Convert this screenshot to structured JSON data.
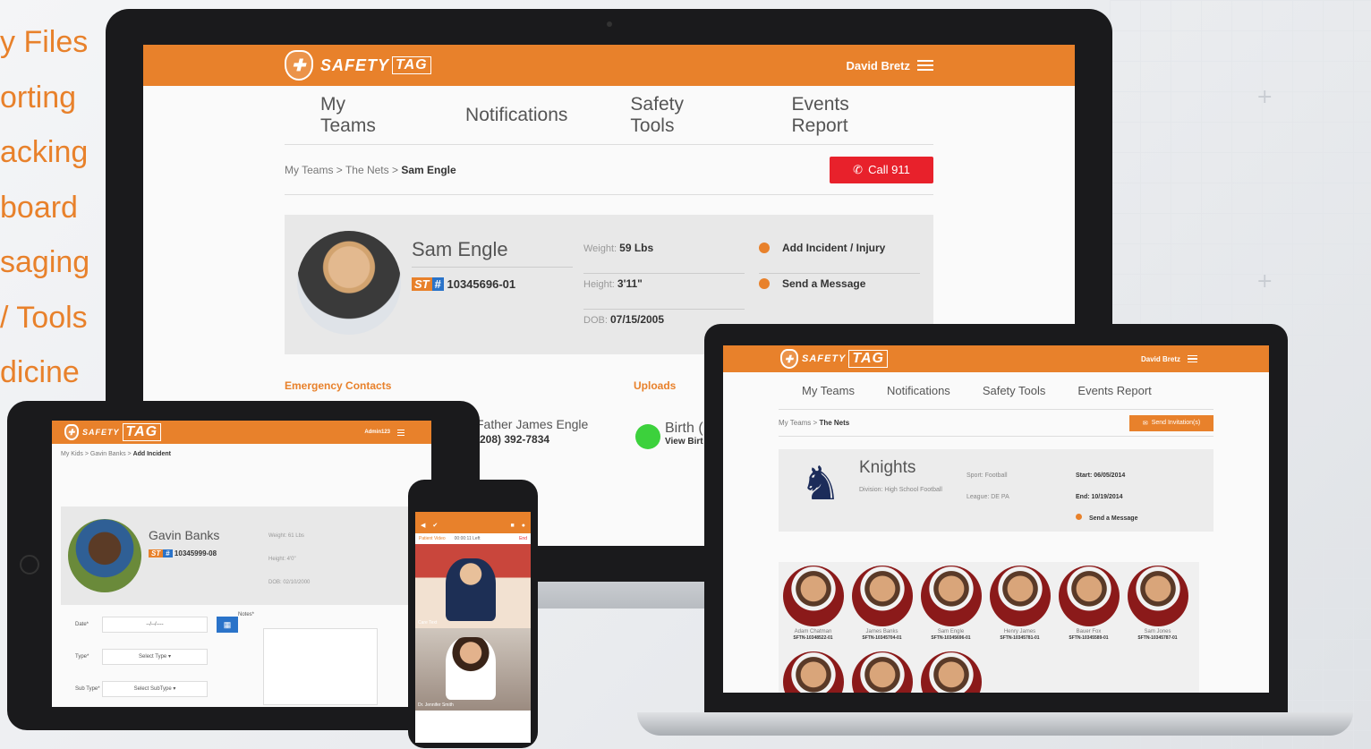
{
  "features": [
    "y Files",
    "orting",
    "acking",
    "board",
    "saging",
    "/ Tools",
    "dicine"
  ],
  "desktop": {
    "logo": "SAFETY",
    "logo_tag": "TAG",
    "user": "David Bretz",
    "nav": [
      "My Teams",
      "Notifications",
      "Safety Tools",
      "Events Report"
    ],
    "breadcrumb": [
      "My Teams",
      "The Nets"
    ],
    "breadcrumb_current": "Sam Engle",
    "call_911": "Call 911",
    "player": {
      "name": "Sam Engle",
      "st_label": "ST",
      "st_id": "10345696-01",
      "weight_label": "Weight:",
      "weight": "59 Lbs",
      "height_label": "Height:",
      "height": "3'11\"",
      "dob_label": "DOB:",
      "dob": "07/15/2005"
    },
    "actions": [
      "Add Incident / Injury",
      "Send a Message"
    ],
    "emergency_title": "Emergency Contacts",
    "uploads_title": "Uploads",
    "contact_name": "Father James Engle",
    "contact_phone": "(208) 392-7834",
    "upload_name": "Birth (",
    "upload_link": "View Birt"
  },
  "laptop": {
    "logo": "SAFETY",
    "logo_tag": "TAG",
    "user": "David Bretz",
    "nav": [
      "My Teams",
      "Notifications",
      "Safety Tools",
      "Events Report"
    ],
    "breadcrumb": [
      "My Teams"
    ],
    "breadcrumb_current": "The Nets",
    "invite_button": "Send Invitation(s)",
    "team": {
      "name": "Knights",
      "sub": "Division: High School Football",
      "sport": "Sport: Football",
      "league": "League: DE PA",
      "start": "Start: 06/05/2014",
      "end": "End: 10/19/2014",
      "message": "Send a Message"
    },
    "roster": [
      {
        "name": "Adam Chatman",
        "id": "SFTN-10348522-01"
      },
      {
        "name": "James Banks",
        "id": "SFTN-10345704-01"
      },
      {
        "name": "Sam Engle",
        "id": "SFTN-10345696-01"
      },
      {
        "name": "Henry James",
        "id": "SFTN-10345781-01"
      },
      {
        "name": "Bauer Fox",
        "id": "SFTN-10345589-01"
      },
      {
        "name": "Sam Jones",
        "id": "SFTN-10345787-01"
      },
      {
        "name": "",
        "id": ""
      },
      {
        "name": "",
        "id": ""
      },
      {
        "name": "",
        "id": ""
      }
    ]
  },
  "tablet": {
    "logo": "SAFETY",
    "logo_tag": "TAG",
    "user": "Admin123",
    "breadcrumb": [
      "My Kids",
      "Gavin Banks"
    ],
    "breadcrumb_current": "Add Incident",
    "player": {
      "name": "Gavin Banks",
      "st_label": "ST",
      "st_id": "10345999-08",
      "weight": "Weight: 61 Lbs",
      "height": "Height: 4'0\"",
      "dob": "DOB: 02/10/2000"
    },
    "form": {
      "date_label": "Date*",
      "date_value": "--/--/----",
      "type_label": "Type*",
      "type_value": "Select Type",
      "subtype_label": "Sub Type*",
      "subtype_value": "Select SubType",
      "notes_label": "Notes*"
    }
  },
  "phone": {
    "tabs": [
      "Patient Video",
      "00:00:11 Left",
      "End"
    ],
    "caption1": "Care Text",
    "caption2": "Dr. Jennifer Smith"
  },
  "colors": {
    "brand_orange": "#e8812b",
    "call_red": "#e8212b",
    "st_blue": "#2a73c9",
    "ok_green": "#3cd13c"
  }
}
